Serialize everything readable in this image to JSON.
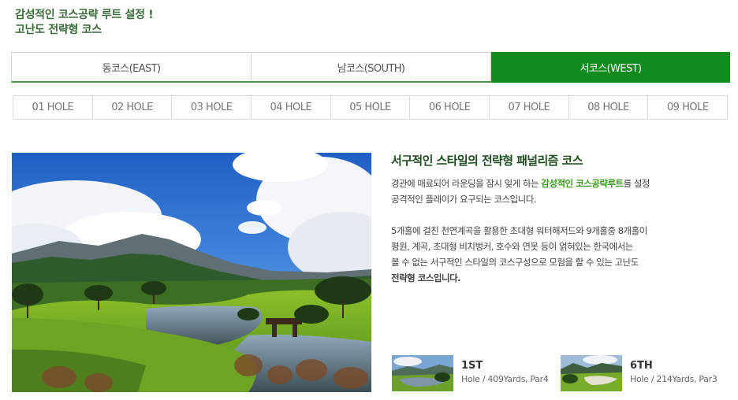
{
  "headline": {
    "line1": "감성적인 코스공략 루트 설정 !",
    "line2": "고난도 전략형 코스"
  },
  "course_tabs": [
    {
      "label": "동코스(EAST)",
      "active": false
    },
    {
      "label": "남코스(SOUTH)",
      "active": false
    },
    {
      "label": "서코스(WEST)",
      "active": true
    }
  ],
  "hole_tabs": [
    "01 HOLE",
    "02 HOLE",
    "03 HOLE",
    "04 HOLE",
    "05 HOLE",
    "06 HOLE",
    "07 HOLE",
    "08 HOLE",
    "09 HOLE"
  ],
  "description": {
    "title": "서구적인 스타일의 전략형 패널리즘 코스",
    "p1_pre": "경관에 매료되어 라운딩을 잠시 잊게 하는 ",
    "p1_hl": "감성적인 코스공략루트",
    "p1_post": "를 설정",
    "p1_line2": "공격적인 플레이가 요구되는 코스입니다.",
    "p2_line1": "5개홀에 걸친 천연계곡을 활용한 초대형 워터해저드와 9개홀중 8개홀이",
    "p2_line2": "평원, 계곡, 초대형 비치벙커, 호수와 연못 등이 얽혀있는 한국에서는",
    "p2_line3": "볼 수 없는 서구적인 스타일의 코스구성으로 모험을 할 수 있는 고난도",
    "p2_hl": "전략형 코스입니다."
  },
  "thumbnails": [
    {
      "number": "1ST",
      "info": "Hole / 409Yards, Par4"
    },
    {
      "number": "6TH",
      "info": "Hole / 214Yards, Par3"
    }
  ],
  "colors": {
    "accent": "#118b1e",
    "headline": "#3a6b3a",
    "highlight": "#3a9a1f"
  }
}
